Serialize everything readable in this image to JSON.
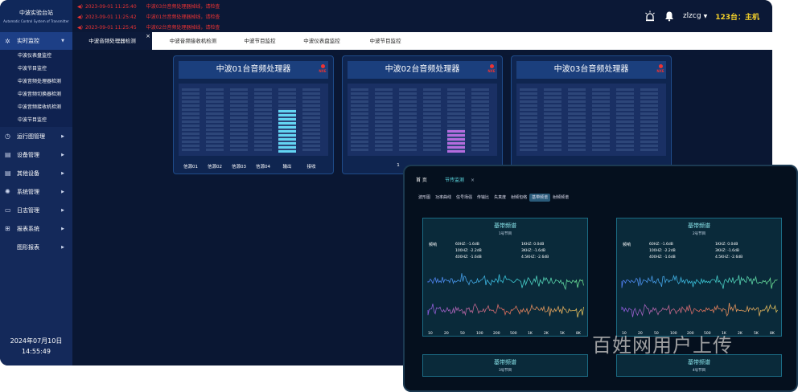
{
  "app": {
    "logo_title": "中波实验台站",
    "logo_subtitle": "Automatic Control System of Transmitter"
  },
  "alarms": [
    {
      "time": "2023-09-01 11:25:40",
      "message": "中波03台音频处理器掉线，请检查"
    },
    {
      "time": "2023-09-01 11:25:42",
      "message": "中波01台音频处理器掉线，请检查"
    },
    {
      "time": "2023-09-01 11:25:45",
      "message": "中波02台音频处理器掉线，请检查"
    }
  ],
  "topright": {
    "user": "zlzcg",
    "station": "123台：主机",
    "icons": [
      "alarm-light-icon",
      "bell-icon"
    ]
  },
  "sidebar": {
    "active_section": "实时监控",
    "active_children": [
      "中波仪表盘监控",
      "中波节目监控",
      "中波音频处理器检测",
      "中波音频切换器检测",
      "中波音频接收机检测",
      "中波节目监控"
    ],
    "sections": [
      "运行图管理",
      "设备管理",
      "其他设备",
      "系统管理",
      "日志管理",
      "报表系统",
      "图形报表"
    ],
    "date": "2024年07月10日",
    "time": "14:55:49"
  },
  "tabs": [
    "中波音频处理器检测",
    "中波音频接收机检测",
    "中波节目监控",
    "中波仪表盘监控",
    "中波节目监控"
  ],
  "panels": [
    {
      "title": "中波01台音频处理器",
      "badge": "NXE",
      "channel_labels": [
        "信源01",
        "信源02",
        "信源03",
        "信源04",
        "输出",
        "接收"
      ],
      "levels": [
        0,
        0,
        0,
        0,
        0.68,
        0
      ],
      "level_color": "#63d5f3"
    },
    {
      "title": "中波02台音频处理器",
      "badge": "NXE",
      "channel_labels": [
        "1"
      ],
      "levels": [
        0,
        0,
        0,
        0,
        0.35,
        0
      ],
      "level_color": "#b46cde"
    },
    {
      "title": "中波03台音频处理器",
      "badge": "NXE",
      "channel_labels": [],
      "levels": [
        0,
        0,
        0,
        0,
        0,
        0
      ],
      "level_color": "#63d5f3"
    }
  ],
  "overlay": {
    "tabs": [
      "首 页",
      "节传监测"
    ],
    "subtabs": [
      "波形图",
      "功率曲线",
      "信号场强",
      "传输比",
      "失真度",
      "射频包络",
      "基带频谱",
      "射频频谱"
    ],
    "active_subtab": "基带频谱",
    "spectra": [
      {
        "title": "基带频谱",
        "subtitle": "1号节目",
        "label": "频响",
        "values_left": [
          "60HZ: -1.6dB",
          "100HZ: -2.2dB",
          "400HZ: -1.6dB"
        ],
        "values_right": [
          "1KHZ: 0.0dB",
          "3KHZ: -1.6dB",
          "4.5KHZ: -2.6dB"
        ],
        "freq_labels": [
          "10",
          "20",
          "50",
          "100",
          "200",
          "500",
          "1K",
          "2K",
          "5K",
          "8K"
        ]
      },
      {
        "title": "基带频谱",
        "subtitle": "2号节目",
        "label": "频响",
        "values_left": [
          "60HZ: -1.6dB",
          "100HZ: -2.2dB",
          "400HZ: -1.6dB"
        ],
        "values_right": [
          "1KHZ: 0.0dB",
          "3KHZ: -1.6dB",
          "4.5KHZ: -2.6dB"
        ],
        "freq_labels": [
          "10",
          "20",
          "50",
          "100",
          "200",
          "500",
          "1K",
          "2K",
          "5K",
          "8K"
        ]
      }
    ],
    "bottom_spectra": [
      {
        "title": "基带频谱",
        "subtitle": "3号节目"
      },
      {
        "title": "基带频谱",
        "subtitle": "4号节目"
      }
    ]
  },
  "watermark": "百姓网用户上传"
}
